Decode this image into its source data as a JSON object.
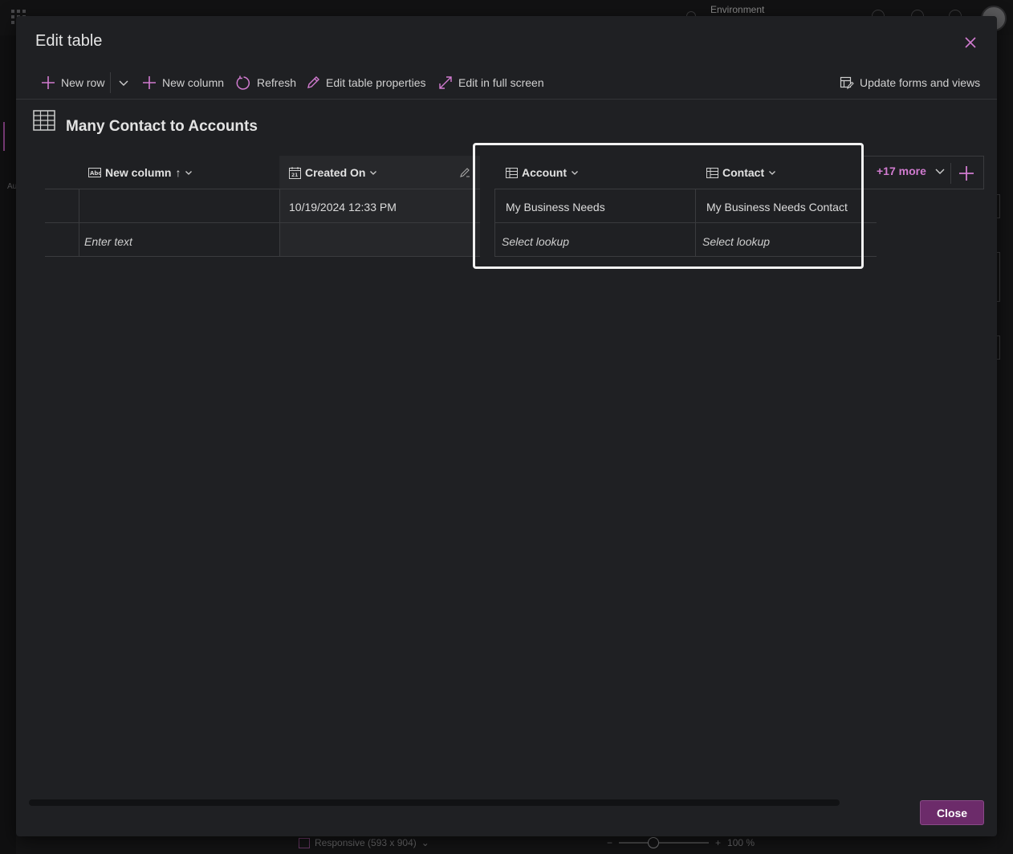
{
  "background": {
    "environment_label": "Environment",
    "responsive_label": "Responsive (593 x 904)",
    "zoom_label": "100 %",
    "left_nav_text": "Au"
  },
  "dialog": {
    "title": "Edit table",
    "toolbar": {
      "new_row": "New row",
      "new_column": "New column",
      "refresh": "Refresh",
      "edit_table_properties": "Edit table properties",
      "edit_full_screen": "Edit in full screen",
      "update_forms_views": "Update forms and views"
    },
    "table_name": "Many Contact to Accounts",
    "columns": [
      {
        "label": "New column",
        "sort_indicator": "↑",
        "type_icon": "text-type-icon"
      },
      {
        "label": "Created On",
        "type_icon": "calendar-icon"
      },
      {
        "label": "Account",
        "type_icon": "lookup-icon"
      },
      {
        "label": "Contact",
        "type_icon": "lookup-icon"
      }
    ],
    "rows": [
      {
        "new_column": "",
        "created_on": "10/19/2024 12:33 PM",
        "account": "My Business Needs",
        "contact": "My Business Needs Contact"
      },
      {
        "new_column": "Enter text",
        "created_on": "",
        "account": "Select lookup",
        "contact": "Select lookup"
      }
    ],
    "more_columns_label": "+17 more",
    "close_button": "Close",
    "accent_color": "#d17bd0",
    "primary_button_color": "#6c2b6a"
  }
}
